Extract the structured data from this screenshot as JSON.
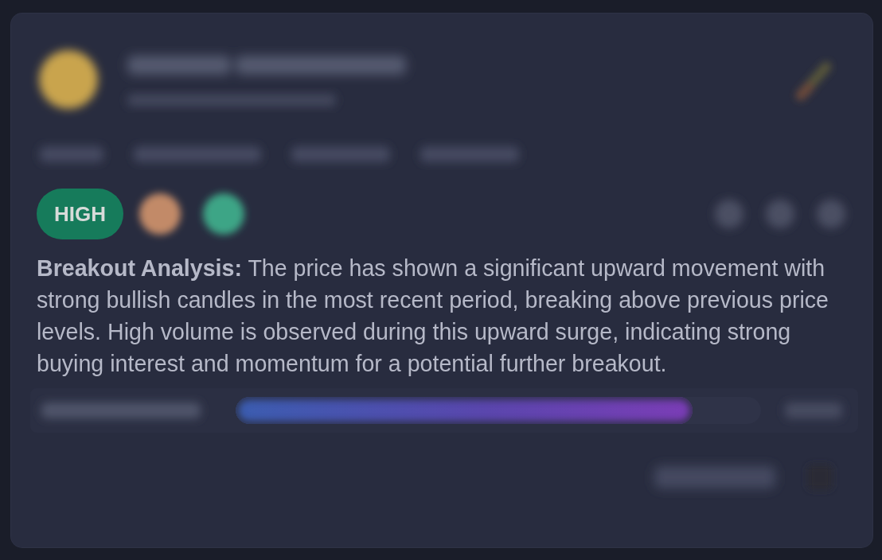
{
  "header": {
    "avatar": {
      "blurred": true
    },
    "title": {
      "blurred": true
    },
    "subtitle": {
      "blurred": true
    },
    "edit": {
      "blurred": true
    }
  },
  "tags": [
    {
      "blurred": true
    },
    {
      "blurred": true
    },
    {
      "blurred": true
    },
    {
      "blurred": true
    }
  ],
  "signal": {
    "badge": "HIGH",
    "kind": "high",
    "indicators": [
      {
        "color": "#c28a68"
      },
      {
        "color": "#3ea586"
      }
    ],
    "actions": [
      {
        "blurred": true
      },
      {
        "blurred": true
      },
      {
        "blurred": true
      }
    ]
  },
  "analysis": {
    "text": "**Breakout Analysis:** The price has shown a significant upward movement with strong bullish candles in the most recent period, breaking above previous price levels. High volume is observed during this upward surge, indicating strong buying interest and momentum for a potential further breakout."
  },
  "strength": {
    "label": {
      "blurred": true
    },
    "level": 0.87,
    "value": {
      "blurred": true
    }
  },
  "footer": {
    "button": {
      "blurred": true
    },
    "icon": {
      "blurred": true
    }
  }
}
